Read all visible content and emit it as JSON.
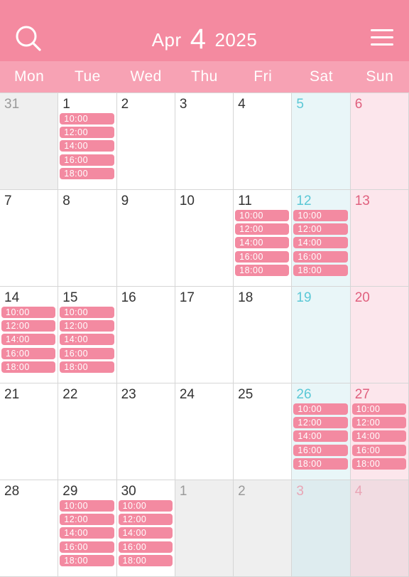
{
  "header": {
    "month": "Apr",
    "month_number": "4",
    "year": "2025",
    "search_icon": "search-icon",
    "menu_icon": "menu-icon"
  },
  "weekdays": [
    "Mon",
    "Tue",
    "Wed",
    "Thu",
    "Fri",
    "Sat",
    "Sun"
  ],
  "colors": {
    "header_bg": "#f48aa0",
    "weekbar_bg": "#f7a2b4",
    "slot_bg": "#f38aa1",
    "saturday_text": "#5bc8d6",
    "sunday_text": "#e0607e"
  },
  "weeks": [
    [
      {
        "day": "31",
        "current": false,
        "slots": []
      },
      {
        "day": "1",
        "current": true,
        "slots": [
          "10:00",
          "12:00",
          "14:00",
          "16:00",
          "18:00"
        ]
      },
      {
        "day": "2",
        "current": true,
        "slots": []
      },
      {
        "day": "3",
        "current": true,
        "slots": []
      },
      {
        "day": "4",
        "current": true,
        "slots": []
      },
      {
        "day": "5",
        "current": true,
        "slots": []
      },
      {
        "day": "6",
        "current": true,
        "slots": []
      }
    ],
    [
      {
        "day": "7",
        "current": true,
        "slots": []
      },
      {
        "day": "8",
        "current": true,
        "slots": []
      },
      {
        "day": "9",
        "current": true,
        "slots": []
      },
      {
        "day": "10",
        "current": true,
        "slots": []
      },
      {
        "day": "11",
        "current": true,
        "slots": [
          "10:00",
          "12:00",
          "14:00",
          "16:00",
          "18:00"
        ]
      },
      {
        "day": "12",
        "current": true,
        "slots": [
          "10:00",
          "12:00",
          "14:00",
          "16:00",
          "18:00"
        ]
      },
      {
        "day": "13",
        "current": true,
        "slots": []
      }
    ],
    [
      {
        "day": "14",
        "current": true,
        "slots": [
          "10:00",
          "12:00",
          "14:00",
          "16:00",
          "18:00"
        ]
      },
      {
        "day": "15",
        "current": true,
        "slots": [
          "10:00",
          "12:00",
          "14:00",
          "16:00",
          "18:00"
        ]
      },
      {
        "day": "16",
        "current": true,
        "slots": []
      },
      {
        "day": "17",
        "current": true,
        "slots": []
      },
      {
        "day": "18",
        "current": true,
        "slots": []
      },
      {
        "day": "19",
        "current": true,
        "slots": []
      },
      {
        "day": "20",
        "current": true,
        "slots": []
      }
    ],
    [
      {
        "day": "21",
        "current": true,
        "slots": []
      },
      {
        "day": "22",
        "current": true,
        "slots": []
      },
      {
        "day": "23",
        "current": true,
        "slots": []
      },
      {
        "day": "24",
        "current": true,
        "slots": []
      },
      {
        "day": "25",
        "current": true,
        "slots": []
      },
      {
        "day": "26",
        "current": true,
        "slots": [
          "10:00",
          "12:00",
          "14:00",
          "16:00",
          "18:00"
        ]
      },
      {
        "day": "27",
        "current": true,
        "slots": [
          "10:00",
          "12:00",
          "14:00",
          "16:00",
          "18:00"
        ]
      }
    ],
    [
      {
        "day": "28",
        "current": true,
        "slots": []
      },
      {
        "day": "29",
        "current": true,
        "slots": [
          "10:00",
          "12:00",
          "14:00",
          "16:00",
          "18:00"
        ]
      },
      {
        "day": "30",
        "current": true,
        "slots": [
          "10:00",
          "12:00",
          "14:00",
          "16:00",
          "18:00"
        ]
      },
      {
        "day": "1",
        "current": false,
        "slots": []
      },
      {
        "day": "2",
        "current": false,
        "slots": []
      },
      {
        "day": "3",
        "current": false,
        "slots": []
      },
      {
        "day": "4",
        "current": false,
        "slots": []
      }
    ]
  ]
}
